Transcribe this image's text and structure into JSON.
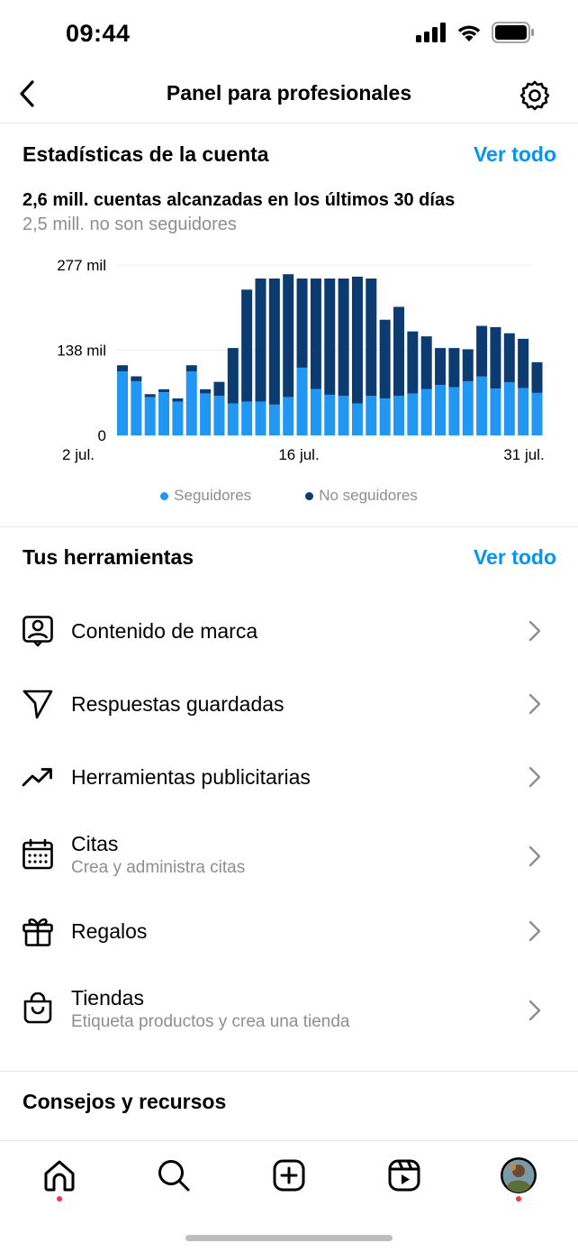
{
  "status_bar": {
    "time": "09:44"
  },
  "header": {
    "title": "Panel para profesionales"
  },
  "account_stats": {
    "title": "Estadísticas de la cuenta",
    "see_all": "Ver todo",
    "reach_headline": "2,6 mill. cuentas alcanzadas en los últimos 30 días",
    "reach_sub": "2,5 mill. no son seguidores"
  },
  "chart_data": {
    "type": "bar",
    "stacked": true,
    "y_tick_labels": [
      "277 mil",
      "138 mil",
      "0"
    ],
    "ylim": [
      0,
      277
    ],
    "x_tick_labels": [
      "2 jul.",
      "16 jul.",
      "31 jul."
    ],
    "categories": [
      "1",
      "2",
      "3",
      "4",
      "5",
      "6",
      "7",
      "8",
      "9",
      "10",
      "11",
      "12",
      "13",
      "14",
      "15",
      "16",
      "17",
      "18",
      "19",
      "20",
      "21",
      "22",
      "23",
      "24",
      "25",
      "26",
      "27",
      "28",
      "29",
      "30"
    ],
    "series": [
      {
        "name": "Seguidores",
        "color": "#2196f3",
        "values": [
          104,
          88,
          62,
          70,
          55,
          104,
          68,
          64,
          52,
          55,
          55,
          50,
          62,
          110,
          75,
          66,
          64,
          52,
          64,
          60,
          64,
          68,
          75,
          82,
          78,
          88,
          96,
          76,
          86,
          77,
          69
        ]
      },
      {
        "name": "No seguidores",
        "color": "#0c3b72",
        "values": [
          10,
          8,
          5,
          5,
          5,
          10,
          7,
          23,
          90,
          182,
          200,
          205,
          200,
          145,
          180,
          189,
          191,
          206,
          191,
          128,
          145,
          101,
          86,
          60,
          64,
          52,
          82,
          100,
          80,
          80,
          50
        ]
      }
    ],
    "legend": [
      "Seguidores",
      "No seguidores"
    ],
    "legend_position": "bottom",
    "grid": true
  },
  "tools": {
    "title": "Tus herramientas",
    "see_all": "Ver todo",
    "items": [
      {
        "label": "Contenido de marca",
        "sub": "",
        "icon": "branded-content-icon"
      },
      {
        "label": "Respuestas guardadas",
        "sub": "",
        "icon": "send-icon"
      },
      {
        "label": "Herramientas publicitarias",
        "sub": "",
        "icon": "trending-up-icon"
      },
      {
        "label": "Citas",
        "sub": "Crea y administra citas",
        "icon": "calendar-icon"
      },
      {
        "label": "Regalos",
        "sub": "",
        "icon": "gift-icon"
      },
      {
        "label": "Tiendas",
        "sub": "Etiqueta productos y crea una tienda",
        "icon": "shopping-bag-icon"
      }
    ]
  },
  "tips": {
    "title": "Consejos y recursos"
  },
  "colors": {
    "accent": "#0095f6",
    "followers": "#2196f3",
    "non_followers": "#0c3b72",
    "notification": "#ff3040"
  }
}
